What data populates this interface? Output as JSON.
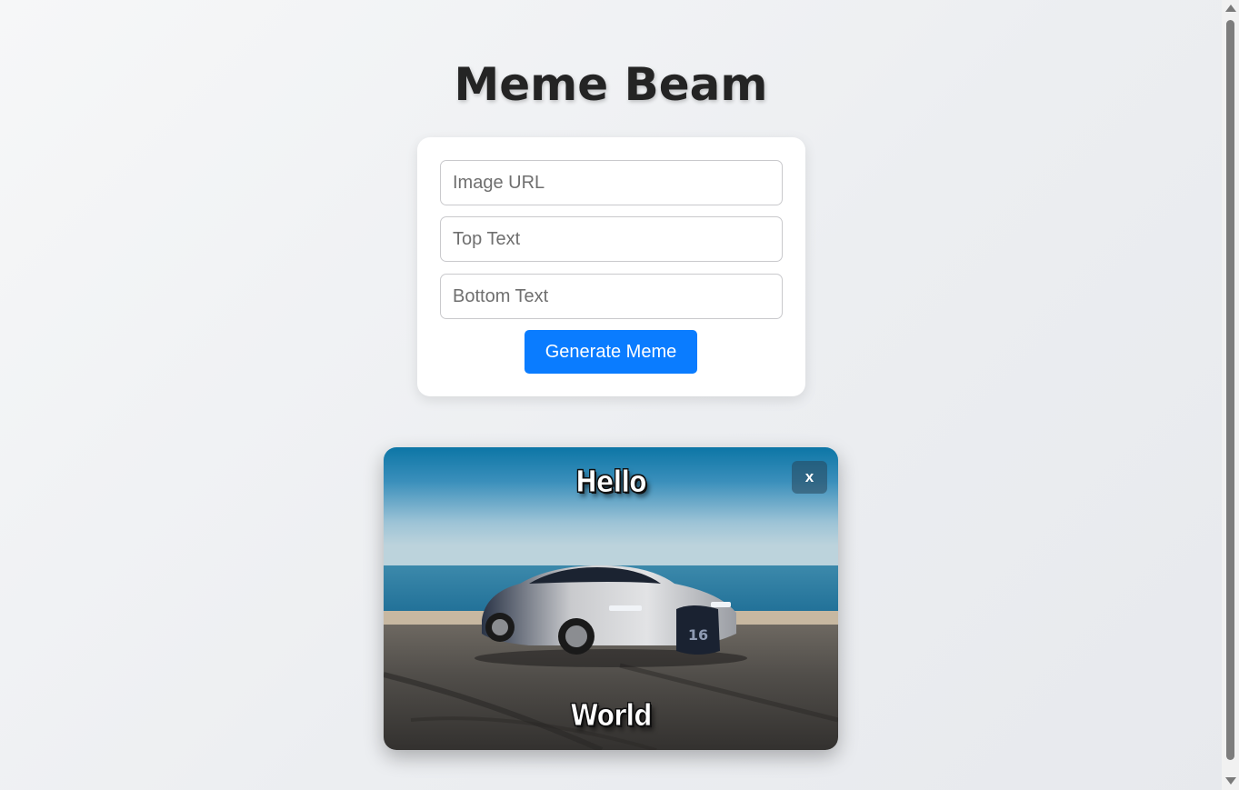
{
  "app": {
    "title": "Meme Beam"
  },
  "form": {
    "image_url_placeholder": "Image URL",
    "top_text_placeholder": "Top Text",
    "bottom_text_placeholder": "Bottom Text",
    "generate_label": "Generate Meme"
  },
  "meme": {
    "top_text": "Hello",
    "bottom_text": "World",
    "close_label": "x",
    "image_subject": "silver sports car on beach by the ocean"
  },
  "colors": {
    "primary_button": "#0a7cff",
    "title_text": "#242424",
    "card_bg": "#ffffff"
  }
}
